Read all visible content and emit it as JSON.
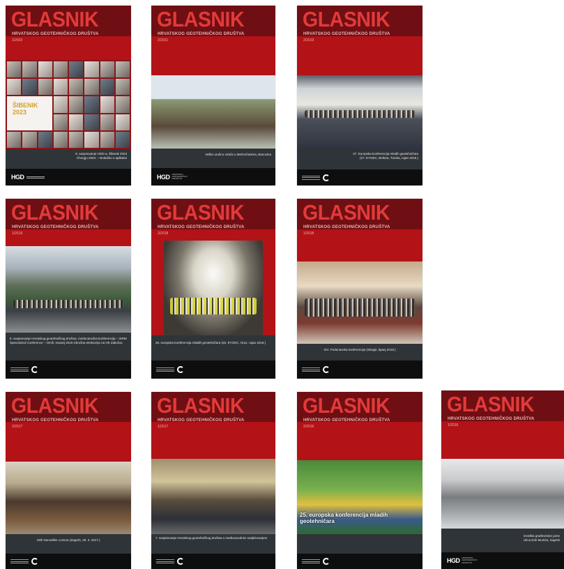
{
  "colors": {
    "cover_red": "#b31217",
    "header_dark_red": "#6f0f13",
    "title_red": "#e23a3a",
    "caption_band": "#2f3438",
    "footer": "#0e0e0e"
  },
  "covers": [
    {
      "title": "GLASNIK",
      "subtitle": "HRVATSKOG GEOTEHNIČKOG DRUŠTVA",
      "issue": "1/2023",
      "caption_1": "8. savjetovanje HGD-a, Šibenik 2023",
      "caption_2": "Ćhorgjo 2023. – Bodačko s aplikatni",
      "grid_label": "ŠIBENIK 2023"
    },
    {
      "title": "GLASNIK",
      "subtitle": "HRVATSKOG GEOTEHNIČKOG DRUŠTVA",
      "issue": "2/2021",
      "caption_1": "Veliko urušno vrtača u Mečenčanima, Banovina",
      "logo_mark": "HGD",
      "logo_text": "HRVATSKO GEOTEHNIČKO DRUŠTVO"
    },
    {
      "title": "GLASNIK",
      "subtitle": "HRVATSKOG GEOTEHNIČKOG DRUŠTVA",
      "issue": "2/2019",
      "caption_1": "27. Europska konferencija mladih geotehničara",
      "caption_2": "(27. EYGEC, Beltura, Turska, rujan 2019.)"
    },
    {
      "title": "GLASNIK",
      "subtitle": "HRVATSKOG GEOTEHNIČKOG DRUŠTVA",
      "issue": "1/2019",
      "caption_1": "8. savjetovanje Hrvatskog geotehničkog društva, međunarodna konferencija – ISRM",
      "caption_2": "Specialized Conference – Omiš, travanj 2019 izbrušna ekskurzija na HE Zakučac"
    },
    {
      "title": "GLASNIK",
      "subtitle": "HRVATSKOG GEOTEHNIČKOG DRUŠTVA",
      "issue": "2/2018",
      "caption_1": "26. europska konferencija mladih geotehničara (26. EYGEC, Graz, rujan 2018.)"
    },
    {
      "title": "GLASNIK",
      "subtitle": "HRVATSKOG GEOTEHNIČKOG DRUŠTVA",
      "issue": "1/2018",
      "caption_1": "XIV. Podunavska konferencija (Skopje, lipanj 2018.)"
    },
    {
      "title": "GLASNIK",
      "subtitle": "HRVATSKOG GEOTEHNIČKOG DRUŠTVA",
      "issue": "2/2017",
      "caption_1": "19th Nonveiller Lecture (Zagreb, 29. 3. 2017.)"
    },
    {
      "title": "GLASNIK",
      "subtitle": "HRVATSKOG GEOTEHNIČKOG DRUŠTVA",
      "issue": "1/2017",
      "caption_1": "7. savjetovanje Hrvatskog geotehničkog društva s međunarodnim sudjelovanjem"
    },
    {
      "title": "GLASNIK",
      "subtitle": "HRVATSKOG GEOTEHNIČKOG DRUŠTVA",
      "issue": "2/2016",
      "caption_1": "25. europska konferencija mladih geotehničara"
    },
    {
      "title": "GLASNIK",
      "subtitle": "HRVATSKOG GEOTEHNIČKOG DRUŠTVA",
      "issue": "1/2016",
      "caption_1": "Izvedba građevinske jame",
      "caption_2": "Ulica Ede Murtića, Zagreb",
      "logo_mark": "HGD",
      "logo_text": "HRVATSKO GEOTEHNIČKO DRUŠTVO"
    }
  ]
}
